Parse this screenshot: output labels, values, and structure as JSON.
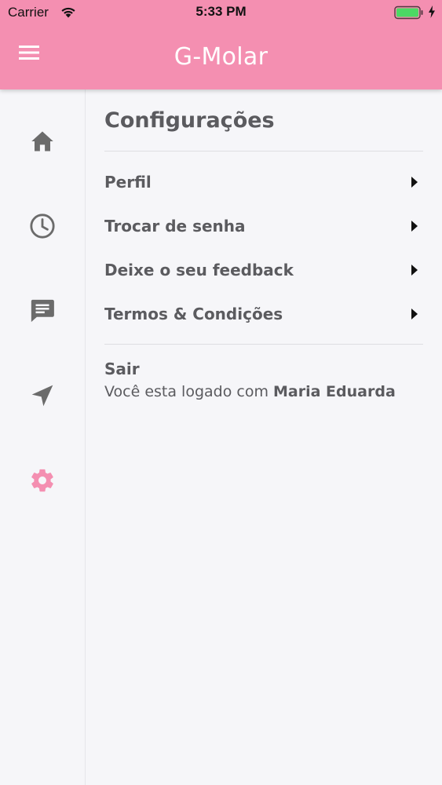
{
  "status_bar": {
    "carrier": "Carrier",
    "time": "5:33 PM",
    "battery_level": 1.0
  },
  "header": {
    "title": "G-Molar",
    "background": "#f48fb1"
  },
  "sidebar": {
    "items": [
      {
        "name": "home",
        "icon": "home-icon",
        "active": false
      },
      {
        "name": "history",
        "icon": "clock-icon",
        "active": false
      },
      {
        "name": "messages",
        "icon": "chat-icon",
        "active": false
      },
      {
        "name": "location",
        "icon": "navigation-icon",
        "active": false
      },
      {
        "name": "settings",
        "icon": "gear-icon",
        "active": true
      }
    ],
    "icon_color": "#6b6b6b",
    "active_color": "#f48fb1"
  },
  "settings": {
    "title": "Configurações",
    "items": [
      {
        "label": "Perfil"
      },
      {
        "label": "Trocar de senha"
      },
      {
        "label": "Deixe o seu feedback"
      },
      {
        "label": "Termos & Condições"
      }
    ],
    "logout": {
      "label": "Sair",
      "logged_prefix": "Você esta logado com",
      "user_name": "Maria Eduarda"
    }
  }
}
